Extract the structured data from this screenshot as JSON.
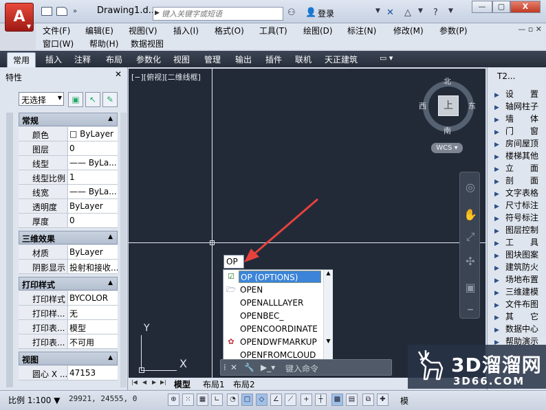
{
  "title_bar": {
    "app_icon": "autocad-logo",
    "doc_title": "Drawing1.d...",
    "search_placeholder": "键入关键字或短语",
    "login_label": "登录"
  },
  "menu": {
    "row1": [
      "文件(F)",
      "编辑(E)",
      "视图(V)",
      "插入(I)",
      "格式(O)",
      "工具(T)",
      "绘图(D)",
      "标注(N)",
      "修改(M)",
      "参数(P)"
    ],
    "row2": [
      "窗口(W)",
      "帮助(H)",
      "数据视图"
    ]
  },
  "ribbon_tabs": [
    "常用",
    "插入",
    "注释",
    "布局",
    "参数化",
    "视图",
    "管理",
    "输出",
    "插件",
    "联机",
    "天正建筑"
  ],
  "properties": {
    "title": "特性",
    "selection": "无选择",
    "sections": {
      "general": "常规",
      "three_d": "三维效果",
      "plot": "打印样式",
      "view": "视图"
    },
    "general_rows": [
      {
        "k": "颜色",
        "v": "ByLayer"
      },
      {
        "k": "图层",
        "v": "0"
      },
      {
        "k": "线型",
        "v": "—— ByLa..."
      },
      {
        "k": "线型比例",
        "v": "1"
      },
      {
        "k": "线宽",
        "v": "—— ByLa..."
      },
      {
        "k": "透明度",
        "v": "ByLayer"
      },
      {
        "k": "厚度",
        "v": "0"
      }
    ],
    "three_d_rows": [
      {
        "k": "材质",
        "v": "ByLayer"
      },
      {
        "k": "阴影显示",
        "v": "投射和接收..."
      }
    ],
    "plot_rows": [
      {
        "k": "打印样式",
        "v": "BYCOLOR"
      },
      {
        "k": "打印样...",
        "v": "无"
      },
      {
        "k": "打印表...",
        "v": "模型"
      },
      {
        "k": "打印表...",
        "v": "不可用"
      }
    ],
    "view_rows": [
      {
        "k": "圆心 X ...",
        "v": "47153"
      }
    ]
  },
  "viewport": {
    "label": "[−][俯视][二维线框]",
    "compass": {
      "north": "北",
      "south": "南",
      "east": "东",
      "west": "西",
      "top": "上"
    },
    "wcs": "WCS",
    "ucs_x": "X",
    "ucs_y": "Y"
  },
  "autocomplete": {
    "typed": "OP",
    "items": [
      "OP (OPTIONS)",
      "OPEN",
      "OPENALLLAYER",
      "OPENBEC_",
      "OPENCOORDINATE",
      "OPENDWFMARKUP",
      "OPENFROMCLOUD"
    ],
    "command_placeholder": "键入命令"
  },
  "t2_panel": {
    "title": "T2...",
    "items": [
      "设　　置",
      "轴网柱子",
      "墙　　体",
      "门　　窗",
      "房间屋顶",
      "楼梯其他",
      "立　　面",
      "剖　　面",
      "文字表格",
      "尺寸标注",
      "符号标注",
      "图层控制",
      "工　　具",
      "图块图案",
      "建筑防火",
      "场地布置",
      "三维建模",
      "文件布图",
      "其　　它",
      "数据中心",
      "帮助演示"
    ]
  },
  "layout_tabs": [
    "模型",
    "布局1",
    "布局2"
  ],
  "status": {
    "scale": "比例 1:100",
    "coords": "29921, 24555, 0",
    "right_text": "模"
  },
  "watermark": {
    "main": "3D溜溜网",
    "sub": "3D66.COM"
  },
  "colors": {
    "canvas": "#222a38",
    "highlight": "#3b84d8",
    "arrow": "#e8413c"
  }
}
